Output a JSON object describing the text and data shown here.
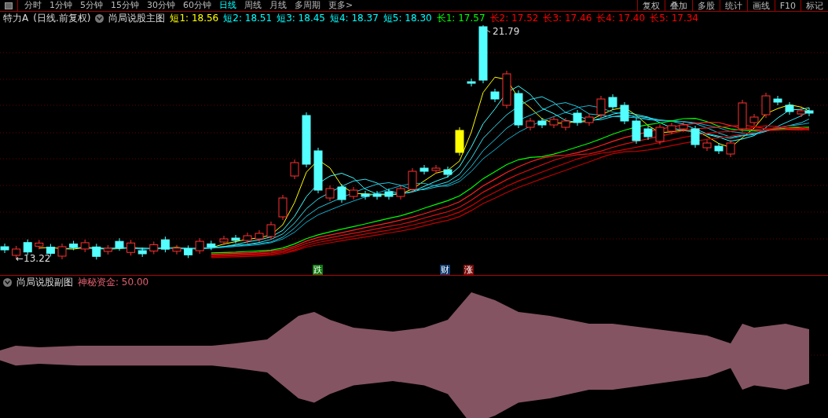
{
  "toolbar": {
    "periods": [
      {
        "label": "分时",
        "selected": false
      },
      {
        "label": "1分钟",
        "selected": false
      },
      {
        "label": "5分钟",
        "selected": false
      },
      {
        "label": "15分钟",
        "selected": false
      },
      {
        "label": "30分钟",
        "selected": false
      },
      {
        "label": "60分钟",
        "selected": false
      },
      {
        "label": "日线",
        "selected": true
      },
      {
        "label": "周线",
        "selected": false
      },
      {
        "label": "月线",
        "selected": false
      },
      {
        "label": "多周期",
        "selected": false
      },
      {
        "label": "更多>",
        "selected": false
      }
    ],
    "buttons": [
      "复权",
      "叠加",
      "多股",
      "统计",
      "画线",
      "F10",
      "标记"
    ]
  },
  "main_chart": {
    "stock": "特力A",
    "mode": "(日线.前复权)",
    "indicator": "尚局说股主图",
    "legend": [
      {
        "text": "短1: 18.56",
        "color": "#ffff00"
      },
      {
        "text": "短2: 18.51",
        "color": "#00ffff"
      },
      {
        "text": "短3: 18.45",
        "color": "#00ffff"
      },
      {
        "text": "短4: 18.37",
        "color": "#00ffff"
      },
      {
        "text": "短5: 18.30",
        "color": "#00ffff"
      },
      {
        "text": "长1: 17.57",
        "color": "#00ff00"
      },
      {
        "text": "长2: 17.52",
        "color": "#ff0000"
      },
      {
        "text": "长3: 17.46",
        "color": "#ff0000"
      },
      {
        "text": "长4: 17.40",
        "color": "#ff0000"
      },
      {
        "text": "长5: 17.34",
        "color": "#ff0000"
      }
    ],
    "high_label": "21.79",
    "low_label": "←13.22",
    "markers": [
      {
        "text": "跌",
        "color": "#0a7a0a"
      },
      {
        "text": "财",
        "color": "#0c3a6e"
      },
      {
        "text": "涨",
        "color": "#7a0a0a"
      }
    ]
  },
  "sub_chart": {
    "indicator": "尚局说股副图",
    "legend": [
      {
        "text": "神秘资金: 50.00",
        "color": "#e0606e"
      }
    ]
  }
}
